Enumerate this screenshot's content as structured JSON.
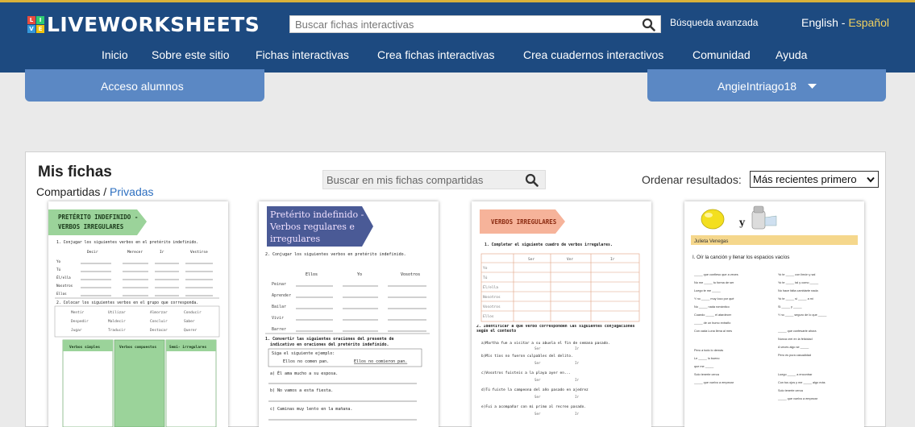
{
  "header": {
    "logo_text": "LIVEWORKSHEETS",
    "logo_letters": [
      "L",
      "I",
      "V",
      "E"
    ],
    "logo_colors": [
      "#e84c3d",
      "#2ecc71",
      "#3498db",
      "#f1c40f"
    ],
    "search_placeholder": "Buscar fichas interactivas",
    "advanced_search": "Búsqueda avanzada",
    "lang_en": "English",
    "lang_sep": " - ",
    "lang_es": "Español"
  },
  "nav": {
    "items": [
      "Inicio",
      "Sobre este sitio",
      "Fichas interactivas",
      "Crea fichas interactivas",
      "Crea cuadernos interactivos",
      "Comunidad",
      "Ayuda"
    ]
  },
  "student_access": "Acceso alumnos",
  "user": {
    "name": "AngieIntriago18"
  },
  "panel": {
    "title": "Mis fichas",
    "tab_shared": "Compartidas",
    "tab_sep": " / ",
    "tab_private": "Privadas",
    "search_placeholder": "Buscar en mis fichas compartidas",
    "sort_label": "Ordenar resultados:",
    "sort_value": "Más recientes primero"
  },
  "colors": {
    "topbar": "#1d4a80",
    "accent_gold": "#d8b13a",
    "tab_button": "#5b88c4",
    "link_blue": "#2d6fc0",
    "card1_banner": "#9bd39a",
    "card2_banner": "#4a5a96",
    "card3_banner": "#f6b39a",
    "card4_banner": "#f5d78c"
  },
  "cards": [
    {
      "title_line1": "PRETÉRITO INDEFINIDO -",
      "title_line2": "VERBOS IRREGULARES",
      "q1": "1. Conjugar los siguientes verbos en el pretérito indefinido.",
      "cols": [
        "Decir",
        "Merecer",
        "Ir",
        "Vestirse"
      ],
      "rows": [
        "Yo",
        "Tú",
        "Él/ella",
        "Nosotros",
        "Ellos"
      ],
      "q2": "2. Colocar los siguientes verbos en el grupo que corresponda.",
      "verbs": [
        "Mentir",
        "Utilizar",
        "Almorzar",
        "Conducir",
        "Despedir",
        "Maldecir",
        "Concluir",
        "Saber",
        "Jugar",
        "Traducir",
        "Destacar",
        "Querer"
      ],
      "box_labels": [
        "Verbos simples",
        "Verbos compuestos",
        "Semi- irregulares"
      ]
    },
    {
      "title_line1": "Pretérito indefinido -",
      "title_line2": "Verbos regulares e",
      "title_line3": "irregulares",
      "q2": "2. Conjugar los siguientes verbos en pretérito indefinido.",
      "cols": [
        "Ellos",
        "Yo",
        "Vosotros"
      ],
      "rows": [
        "Peinar",
        "Aprender",
        "Bailar",
        "Vivir",
        "Barrer"
      ],
      "q1_a": "1. Convertir las siguientes oraciones del presente de",
      "q1_b": "indicativo en oraciones del pretérito indefinido.",
      "example_label": "Siga el siguiente ejemplo:",
      "example_a": "Ellos no comen pan.",
      "example_b": "Ellos no comieron pan.",
      "sent_a": "a) Él ama mucho a su esposa.",
      "sent_b": "b) No vamos a esta fiesta.",
      "sent_c": "c) Caminas muy lento en la mañana."
    },
    {
      "title": "VERBOS IRREGULARES",
      "q1": "1. Completar el siguiente cuadro de verbos irregulares.",
      "cols": [
        "Ser",
        "Ver",
        "Ir"
      ],
      "rows": [
        "Yo",
        "Tú",
        "Él/ella",
        "Nosotros",
        "Vosotros",
        "Ellos"
      ],
      "q2": "2. Identificar a qué verbo corresponden las siguientes conjugaciones según el contexto",
      "sents": [
        "a)Martha fue a visitar a su abuela el fin de semana pasado.",
        "b)Mis tíos no fueron culpables del delito.",
        "c)Vosotros fuisteis a la playa ayer en...",
        "d)Tú fuiste la campeona del año pasado en ajedrez",
        "e)Fui a acompañar con mi primo al recreo pasado."
      ],
      "options": [
        "Ser",
        "Ir"
      ]
    },
    {
      "symbol": "y",
      "author": "Julieta Venegas",
      "instruction": "I. Oír la canción y llenar los espacios vacíos",
      "left_lines": [
        "_____ que confieso que a veces",
        "No me _____ tu forma de ser",
        "Luego te me _____",
        "Y no _____ muy loco por qué",
        "No _____ nada romántico",
        "Cuando _____ el atardecer",
        "_____ de un humo extraño",
        "Con cada Luna llena al mes",
        "Pero a todo lo demás",
        "Le _____ lo bueno",
        "que me _____",
        "Solo tenerte cerca",
        "_____ que vuelvo a empezar"
      ],
      "right_lines": [
        "Yo te _____ con limón y sal",
        "Yo te _____ tal y como _____",
        "No hace falta cambiarte nada",
        "Yo te _____ si _____ a mi",
        "Si _____ y _____",
        "Y no _____ seguro de lo que _____",
        "_____ que confesarte ahora",
        "Nunca creí en la felicidad",
        "A veces algo se _____",
        "Pero es pura casualidad",
        "Luego _____ a encontrar",
        "Con tus ojos y me _____ algo más",
        "Solo tenerte cerca",
        "_____ que vuelvo a empezar"
      ]
    }
  ]
}
